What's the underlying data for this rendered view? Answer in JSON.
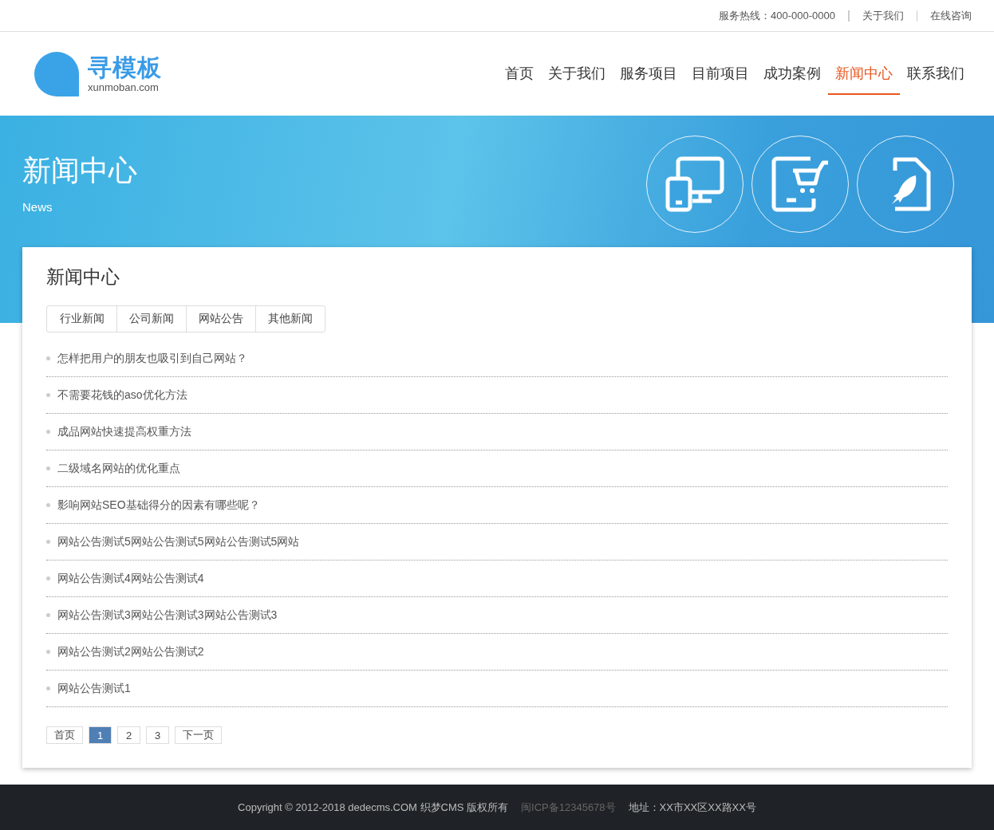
{
  "top_bar": {
    "hotline": "服务热线：400-000-0000",
    "links": [
      "关于我们",
      "在线咨询"
    ]
  },
  "logo": {
    "name": "寻模板",
    "domain": "xunmoban.com"
  },
  "nav": [
    {
      "label": "首页",
      "selected": false
    },
    {
      "label": "关于我们",
      "selected": false
    },
    {
      "label": "服务项目",
      "selected": false
    },
    {
      "label": "目前项目",
      "selected": false
    },
    {
      "label": "成功案例",
      "selected": false
    },
    {
      "label": "新闻中心",
      "selected": true
    },
    {
      "label": "联系我们",
      "selected": false
    }
  ],
  "banner": {
    "title": "新闻中心",
    "subtitle": "News"
  },
  "content": {
    "title": "新闻中心",
    "tabs": [
      "行业新闻",
      "公司新闻",
      "网站公告",
      "其他新闻"
    ],
    "articles": [
      "怎样把用户的朋友也吸引到自己网站？",
      "不需要花钱的aso优化方法",
      "成品网站快速提高权重方法",
      "二级域名网站的优化重点",
      "影响网站SEO基础得分的因素有哪些呢？",
      "网站公告测试5网站公告测试5网站公告测试5网站",
      "网站公告测试4网站公告测试4",
      "网站公告测试3网站公告测试3网站公告测试3",
      "网站公告测试2网站公告测试2",
      "网站公告测试1"
    ],
    "pagination": [
      {
        "label": "首页",
        "selected": false
      },
      {
        "label": "1",
        "selected": true
      },
      {
        "label": "2",
        "selected": false
      },
      {
        "label": "3",
        "selected": false
      },
      {
        "label": "下一页",
        "selected": false
      }
    ]
  },
  "footer": {
    "copyright": "Copyright © 2012-2018 dedecms.COM 织梦CMS 版权所有",
    "icp": "闽ICP备12345678号",
    "address": "地址：XX市XX区XX路XX号"
  }
}
